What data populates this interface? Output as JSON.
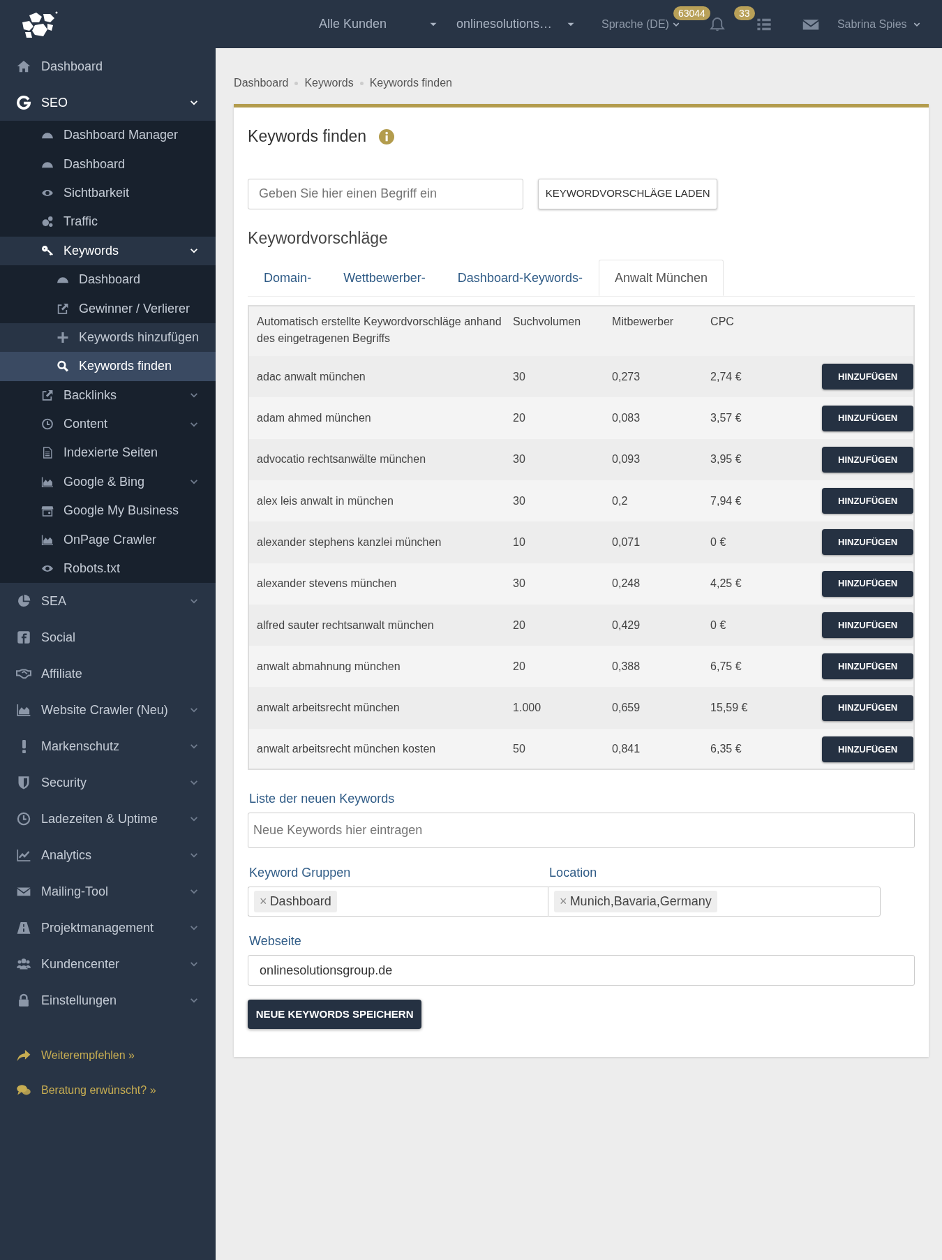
{
  "topbar": {
    "customer_select": "Alle Kunden",
    "project_select": "onlinesolutions…",
    "language": "Sprache (DE)",
    "notifications_count": "63044",
    "tasks_count": "33",
    "user": "Sabrina Spies"
  },
  "sidebar": {
    "items": [
      {
        "label": "Dashboard",
        "selected": false
      },
      {
        "label": "SEO",
        "selected": false,
        "expanded": true,
        "children": [
          {
            "label": "Dashboard Manager",
            "selected": false
          },
          {
            "label": "Dashboard",
            "selected": false
          },
          {
            "label": "Sichtbarkeit",
            "selected": false
          },
          {
            "label": "Traffic",
            "selected": false
          },
          {
            "label": "Keywords",
            "selected": false,
            "expanded": true,
            "children": [
              {
                "label": "Dashboard",
                "selected": false,
                "highlighted": false
              },
              {
                "label": "Gewinner / Verlierer",
                "selected": false,
                "highlighted": false
              },
              {
                "label": "Keywords hinzufügen",
                "selected": false,
                "highlighted": true
              },
              {
                "label": "Keywords finden",
                "selected": true,
                "highlighted": true
              }
            ]
          },
          {
            "label": "Backlinks",
            "selected": false,
            "expanded": false
          },
          {
            "label": "Content",
            "selected": false,
            "expanded": false
          },
          {
            "label": "Indexierte Seiten",
            "selected": false
          },
          {
            "label": "Google & Bing",
            "selected": false,
            "expanded": false
          },
          {
            "label": "Google My Business",
            "selected": false
          },
          {
            "label": "OnPage Crawler",
            "selected": false
          },
          {
            "label": "Robots.txt",
            "selected": false
          }
        ]
      },
      {
        "label": "SEA",
        "selected": false,
        "expanded": false
      },
      {
        "label": "Social",
        "selected": false
      },
      {
        "label": "Affiliate",
        "selected": false
      },
      {
        "label": "Website Crawler (Neu)",
        "selected": false,
        "expanded": false
      },
      {
        "label": "Markenschutz",
        "selected": false,
        "expanded": false
      },
      {
        "label": "Security",
        "selected": false,
        "expanded": false
      },
      {
        "label": "Ladezeiten & Uptime",
        "selected": false,
        "expanded": false
      },
      {
        "label": "Analytics",
        "selected": false,
        "expanded": false
      },
      {
        "label": "Mailing-Tool",
        "selected": false,
        "expanded": false
      },
      {
        "label": "Projektmanagement",
        "selected": false,
        "expanded": false
      },
      {
        "label": "Kundencenter",
        "selected": false,
        "expanded": false
      },
      {
        "label": "Einstellungen",
        "selected": false,
        "expanded": false
      }
    ],
    "footer_links": [
      "Weiterempfehlen »",
      "Beratung erwünscht? »"
    ]
  },
  "breadcrumb": [
    "Dashboard",
    "Keywords",
    "Keywords finden"
  ],
  "card": {
    "title": "Keywords finden",
    "search": {
      "placeholder": "Geben Sie hier einen Begriff ein"
    },
    "load_button": "KEYWORDVORSCHLÄGE LADEN",
    "section_title": "Keywordvorschläge",
    "tabs": [
      {
        "label": "Domain-",
        "selected": false
      },
      {
        "label": "Wettbewerber-",
        "selected": false
      },
      {
        "label": "Dashboard-Keywords-",
        "selected": false
      },
      {
        "label": "Anwalt München",
        "selected": true
      }
    ],
    "table": {
      "columns": [
        "Automatisch erstellte Keywordvorschläge anhand des eingetragenen Begriffs",
        "Suchvolumen",
        "Mitbewerber",
        "CPC"
      ],
      "rows": [
        {
          "keyword": "adac anwalt münchen",
          "volume": "30",
          "competition": "0,273",
          "cpc": "2,74 €",
          "button": "HINZUFÜGEN"
        },
        {
          "keyword": "adam ahmed münchen",
          "volume": "20",
          "competition": "0,083",
          "cpc": "3,57 €",
          "button": "HINZUFÜGEN"
        },
        {
          "keyword": "advocatio rechtsanwälte münchen",
          "volume": "30",
          "competition": "0,093",
          "cpc": "3,95 €",
          "button": "HINZUFÜGEN"
        },
        {
          "keyword": "alex leis anwalt in münchen",
          "volume": "30",
          "competition": "0,2",
          "cpc": "7,94 €",
          "button": "HINZUFÜGEN"
        },
        {
          "keyword": "alexander stephens kanzlei münchen",
          "volume": "10",
          "competition": "0,071",
          "cpc": "0 €",
          "button": "HINZUFÜGEN"
        },
        {
          "keyword": "alexander stevens münchen",
          "volume": "30",
          "competition": "0,248",
          "cpc": "4,25 €",
          "button": "HINZUFÜGEN"
        },
        {
          "keyword": "alfred sauter rechtsanwalt münchen",
          "volume": "20",
          "competition": "0,429",
          "cpc": "0 €",
          "button": "HINZUFÜGEN"
        },
        {
          "keyword": "anwalt abmahnung münchen",
          "volume": "20",
          "competition": "0,388",
          "cpc": "6,75 €",
          "button": "HINZUFÜGEN"
        },
        {
          "keyword": "anwalt arbeitsrecht münchen",
          "volume": "1.000",
          "competition": "0,659",
          "cpc": "15,59 €",
          "button": "HINZUFÜGEN"
        },
        {
          "keyword": "anwalt arbeitsrecht münchen kosten",
          "volume": "50",
          "competition": "0,841",
          "cpc": "6,35 €",
          "button": "HINZUFÜGEN"
        }
      ]
    },
    "new_keywords": {
      "label": "Liste der neuen Keywords",
      "placeholder": "Neue Keywords hier eintragen"
    },
    "groups": {
      "label": "Keyword Gruppen",
      "tags": [
        {
          "remove": "×",
          "label": "Dashboard"
        }
      ]
    },
    "location": {
      "label": "Location",
      "tags": [
        {
          "remove": "×",
          "label": "Munich,Bavaria,Germany"
        }
      ]
    },
    "website": {
      "label": "Webseite",
      "value": "onlinesolutionsgroup.de"
    },
    "save_button": "NEUE KEYWORDS SPEICHERN"
  }
}
